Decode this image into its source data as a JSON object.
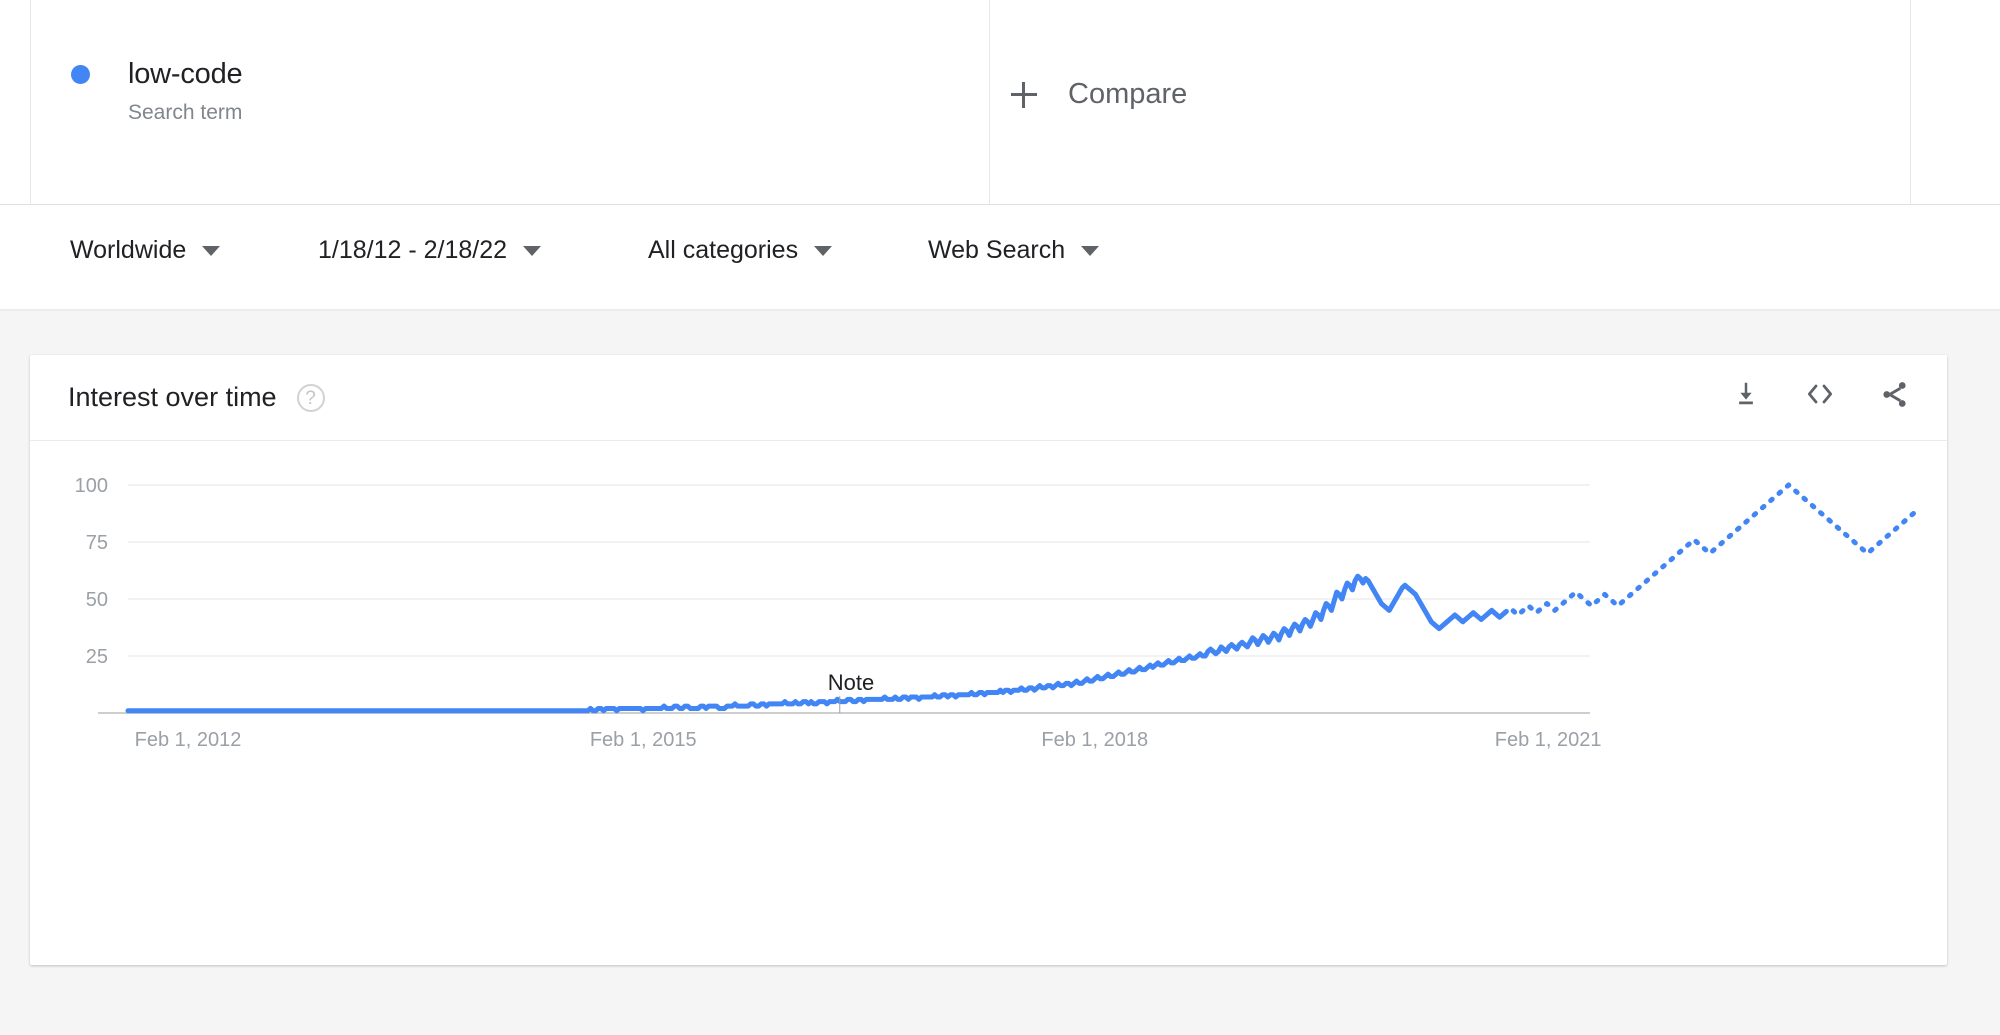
{
  "header": {
    "term": {
      "name": "low-code",
      "subtitle": "Search term",
      "dot_color": "#4285f4"
    },
    "compare": {
      "label": "Compare",
      "icon": "plus-icon"
    }
  },
  "filters": {
    "region": "Worldwide",
    "time_range": "1/18/12 - 2/18/22",
    "category": "All categories",
    "search_property": "Web Search"
  },
  "card": {
    "title": "Interest over time",
    "help_icon": "question-mark-icon",
    "actions": [
      {
        "name": "download-csv-button",
        "icon": "download-icon"
      },
      {
        "name": "embed-button",
        "icon": "code-brackets-icon"
      },
      {
        "name": "share-button",
        "icon": "share-icon"
      }
    ]
  },
  "chart_data": {
    "type": "line",
    "title": "Interest over time",
    "xlabel": "",
    "ylabel": "",
    "ylim": [
      0,
      100
    ],
    "yticks": [
      25,
      50,
      75,
      100
    ],
    "grid": true,
    "legend_position": "top-left",
    "line_color": "#4285f4",
    "line_width": 5,
    "series_name": "low-code",
    "xticks": [
      "Feb 1, 2012",
      "Feb 1, 2015",
      "Feb 1, 2018",
      "Feb 1, 2021"
    ],
    "xtick_positions": [
      0.0335,
      0.2875,
      0.5395,
      0.7925
    ],
    "annotations": [
      {
        "text": "Note",
        "x_frac": 0.3905,
        "y_value": 4
      }
    ],
    "partial_data_from_index": 524,
    "values": [
      1,
      1,
      1,
      1,
      1,
      1,
      1,
      1,
      1,
      1,
      1,
      1,
      1,
      1,
      1,
      1,
      1,
      1,
      1,
      1,
      1,
      1,
      1,
      1,
      1,
      1,
      1,
      1,
      1,
      1,
      1,
      1,
      1,
      1,
      1,
      1,
      1,
      1,
      1,
      1,
      1,
      1,
      1,
      1,
      1,
      1,
      1,
      1,
      1,
      1,
      1,
      1,
      1,
      1,
      1,
      1,
      1,
      1,
      1,
      1,
      1,
      1,
      1,
      1,
      1,
      1,
      1,
      1,
      1,
      1,
      1,
      1,
      1,
      1,
      1,
      1,
      1,
      1,
      1,
      1,
      1,
      1,
      1,
      1,
      1,
      1,
      1,
      1,
      1,
      1,
      1,
      1,
      1,
      1,
      1,
      1,
      1,
      1,
      1,
      1,
      1,
      1,
      1,
      1,
      1,
      1,
      1,
      1,
      1,
      1,
      1,
      1,
      1,
      1,
      1,
      1,
      1,
      1,
      1,
      1,
      1,
      1,
      1,
      1,
      1,
      1,
      1,
      1,
      1,
      1,
      1,
      1,
      1,
      1,
      1,
      1,
      1,
      1,
      1,
      1,
      1,
      1,
      1,
      1,
      1,
      1,
      1,
      1,
      1,
      1,
      1,
      1,
      1,
      1,
      1,
      1,
      1,
      1,
      1,
      1,
      1,
      1,
      1,
      1,
      1,
      1,
      1,
      1,
      1,
      1,
      1,
      1,
      1,
      1,
      1,
      1,
      2,
      1,
      1,
      2,
      2,
      1,
      2,
      2,
      2,
      2,
      1,
      2,
      2,
      2,
      2,
      2,
      2,
      2,
      2,
      2,
      1,
      2,
      2,
      2,
      2,
      2,
      2,
      2,
      3,
      2,
      2,
      2,
      3,
      3,
      2,
      2,
      3,
      3,
      2,
      2,
      2,
      2,
      3,
      3,
      2,
      3,
      3,
      3,
      3,
      2,
      2,
      2,
      3,
      3,
      3,
      4,
      3,
      3,
      3,
      3,
      3,
      4,
      4,
      3,
      3,
      4,
      4,
      3,
      4,
      4,
      4,
      4,
      4,
      4,
      5,
      4,
      4,
      4,
      5,
      4,
      4,
      5,
      5,
      4,
      5,
      4,
      4,
      5,
      5,
      5,
      4,
      5,
      5,
      5,
      6,
      5,
      5,
      5,
      6,
      6,
      5,
      5,
      6,
      6,
      5,
      6,
      6,
      6,
      6,
      6,
      6,
      6,
      7,
      6,
      6,
      6,
      7,
      6,
      6,
      7,
      7,
      6,
      7,
      7,
      7,
      6,
      7,
      7,
      7,
      7,
      7,
      8,
      7,
      7,
      8,
      8,
      7,
      8,
      8,
      7,
      8,
      8,
      8,
      8,
      8,
      9,
      8,
      8,
      9,
      9,
      8,
      9,
      9,
      9,
      9,
      9,
      10,
      9,
      10,
      10,
      9,
      10,
      10,
      10,
      11,
      10,
      10,
      11,
      11,
      10,
      11,
      12,
      11,
      11,
      12,
      12,
      11,
      12,
      13,
      12,
      12,
      13,
      13,
      12,
      13,
      14,
      13,
      13,
      14,
      15,
      14,
      14,
      15,
      16,
      15,
      15,
      16,
      17,
      16,
      16,
      17,
      18,
      17,
      17,
      18,
      19,
      18,
      18,
      19,
      20,
      19,
      19,
      20,
      21,
      20,
      21,
      22,
      21,
      21,
      22,
      23,
      22,
      22,
      23,
      24,
      23,
      23,
      24,
      25,
      24,
      24,
      25,
      26,
      25,
      25,
      27,
      28,
      27,
      26,
      27,
      29,
      28,
      27,
      29,
      30,
      29,
      28,
      30,
      31,
      30,
      29,
      31,
      33,
      32,
      30,
      32,
      34,
      33,
      31,
      33,
      35,
      34,
      32,
      35,
      37,
      36,
      34,
      37,
      39,
      38,
      36,
      39,
      41,
      40,
      38,
      41,
      44,
      43,
      41,
      45,
      48,
      47,
      45,
      49,
      53,
      52,
      50,
      54,
      57,
      56,
      54,
      58,
      60,
      59,
      57,
      59,
      58,
      56,
      54,
      52,
      50,
      48,
      47,
      46,
      45,
      47,
      49,
      51,
      53,
      55,
      56,
      55,
      54,
      53,
      52,
      50,
      48,
      46,
      44,
      42,
      40,
      39,
      38,
      37,
      38,
      39,
      40,
      41,
      42,
      43,
      42,
      41,
      40,
      41,
      42,
      43,
      44,
      43,
      42,
      41,
      42,
      43,
      44,
      45,
      44,
      43,
      42,
      43,
      44,
      45,
      46,
      45,
      44,
      43,
      44,
      45,
      46,
      47,
      46,
      45,
      44,
      45,
      46,
      47,
      48,
      47,
      46,
      45,
      46,
      47,
      48,
      49,
      50,
      51,
      52,
      53,
      52,
      51,
      50,
      49,
      48,
      47,
      48,
      49,
      50,
      51,
      52,
      51,
      50,
      49,
      48,
      47,
      48,
      49,
      50,
      51,
      52,
      53,
      54,
      55,
      56,
      57,
      58,
      59,
      60,
      61,
      62,
      63,
      64,
      65,
      66,
      67,
      68,
      69,
      70,
      71,
      72,
      73,
      74,
      75,
      76,
      75,
      74,
      73,
      72,
      71,
      70,
      71,
      72,
      73,
      74,
      75,
      76,
      77,
      78,
      79,
      80,
      81,
      82,
      83,
      84,
      85,
      86,
      87,
      88,
      89,
      90,
      91,
      92,
      93,
      94,
      95,
      96,
      97,
      98,
      99,
      100,
      99,
      98,
      97,
      96,
      95,
      94,
      93,
      92,
      91,
      90,
      89,
      88,
      87,
      86,
      85,
      84,
      83,
      82,
      81,
      80,
      79,
      78,
      77,
      76,
      75,
      74,
      73,
      72,
      71,
      70,
      71,
      72,
      73,
      74,
      75,
      76,
      77,
      78,
      79,
      80,
      81,
      82,
      83,
      84,
      85,
      86,
      87,
      88,
      89,
      90
    ]
  }
}
